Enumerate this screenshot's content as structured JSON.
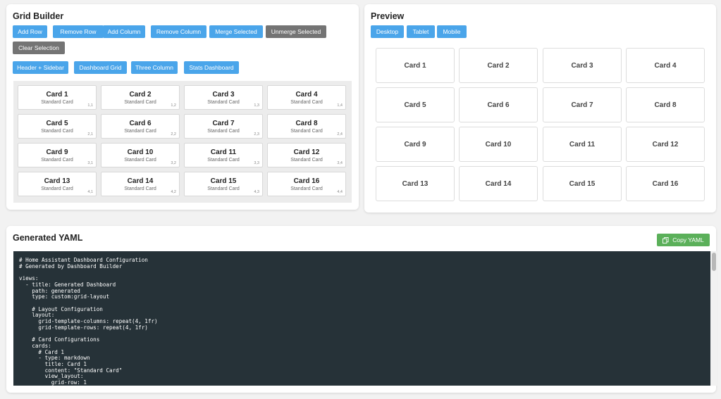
{
  "builder": {
    "title": "Grid Builder",
    "actions": [
      "Add Row",
      "Remove Row",
      "Add Column",
      "Remove Column",
      "Merge Selected",
      "Unmerge Selected",
      "Clear Selection"
    ],
    "templates": [
      "Header + Sidebar",
      "Dashboard Grid",
      "Three Column",
      "Stats Dashboard"
    ],
    "cells": [
      {
        "title": "Card 1",
        "subtitle": "Standard Card",
        "pos": "1,1"
      },
      {
        "title": "Card 2",
        "subtitle": "Standard Card",
        "pos": "1,2"
      },
      {
        "title": "Card 3",
        "subtitle": "Standard Card",
        "pos": "1,3"
      },
      {
        "title": "Card 4",
        "subtitle": "Standard Card",
        "pos": "1,4"
      },
      {
        "title": "Card 5",
        "subtitle": "Standard Card",
        "pos": "2,1"
      },
      {
        "title": "Card 6",
        "subtitle": "Standard Card",
        "pos": "2,2"
      },
      {
        "title": "Card 7",
        "subtitle": "Standard Card",
        "pos": "2,3"
      },
      {
        "title": "Card 8",
        "subtitle": "Standard Card",
        "pos": "2,4"
      },
      {
        "title": "Card 9",
        "subtitle": "Standard Card",
        "pos": "3,1"
      },
      {
        "title": "Card 10",
        "subtitle": "Standard Card",
        "pos": "3,2"
      },
      {
        "title": "Card 11",
        "subtitle": "Standard Card",
        "pos": "3,3"
      },
      {
        "title": "Card 12",
        "subtitle": "Standard Card",
        "pos": "3,4"
      },
      {
        "title": "Card 13",
        "subtitle": "Standard Card",
        "pos": "4,1"
      },
      {
        "title": "Card 14",
        "subtitle": "Standard Card",
        "pos": "4,2"
      },
      {
        "title": "Card 15",
        "subtitle": "Standard Card",
        "pos": "4,3"
      },
      {
        "title": "Card 16",
        "subtitle": "Standard Card",
        "pos": "4,4"
      }
    ]
  },
  "preview": {
    "title": "Preview",
    "devices": [
      "Desktop",
      "Tablet",
      "Mobile"
    ],
    "cards": [
      "Card 1",
      "Card 2",
      "Card 3",
      "Card 4",
      "Card 5",
      "Card 6",
      "Card 7",
      "Card 8",
      "Card 9",
      "Card 10",
      "Card 11",
      "Card 12",
      "Card 13",
      "Card 14",
      "Card 15",
      "Card 16"
    ]
  },
  "yaml": {
    "title": "Generated YAML",
    "copy_label": "Copy YAML",
    "copy_icon": "copy-icon",
    "code": "# Home Assistant Dashboard Configuration\n# Generated by Dashboard Builder\n\nviews:\n  - title: Generated Dashboard\n    path: generated\n    type: custom:grid-layout\n\n    # Layout Configuration\n    layout:\n      grid-template-columns: repeat(4, 1fr)\n      grid-template-rows: repeat(4, 1fr)\n\n    # Card Configurations\n    cards:\n      # Card 1\n      - type: markdown\n        title: Card 1\n        content: \"Standard Card\"\n        view_layout:\n          grid-row: 1"
  },
  "colors": {
    "primary": "#4aa5ea",
    "secondary": "#747474",
    "success": "#5bb05a",
    "code_bg": "#263238"
  }
}
